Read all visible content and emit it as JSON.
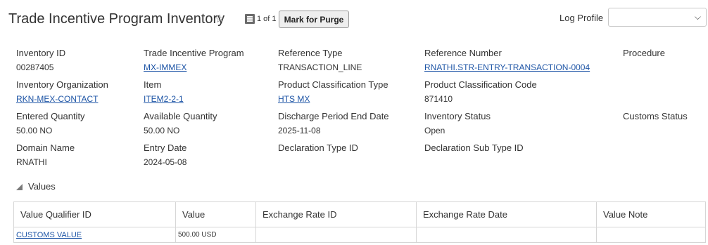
{
  "header": {
    "title": "Trade Incentive Program Inventory",
    "pager": "1 of 1",
    "mark_purge_label": "Mark for Purge",
    "log_profile_label": "Log Profile",
    "log_profile_value": ""
  },
  "fields": {
    "inventory_id": {
      "label": "Inventory ID",
      "value": "00287405"
    },
    "trade_incentive_program": {
      "label": "Trade Incentive Program",
      "value": "MX-IMMEX"
    },
    "reference_type": {
      "label": "Reference Type",
      "value": "TRANSACTION_LINE"
    },
    "reference_number": {
      "label": "Reference Number",
      "value": "RNATHI.STR-ENTRY-TRANSACTION-0004"
    },
    "procedure": {
      "label": "Procedure",
      "value": ""
    },
    "inventory_organization": {
      "label": "Inventory Organization",
      "value": "RKN-MEX-CONTACT"
    },
    "item": {
      "label": "Item",
      "value": "ITEM2-2-1"
    },
    "product_classification_type": {
      "label": "Product Classification Type",
      "value": "HTS MX"
    },
    "product_classification_code": {
      "label": "Product Classification Code",
      "value": "871410"
    },
    "entered_quantity": {
      "label": "Entered Quantity",
      "value": "50.00 NO"
    },
    "available_quantity": {
      "label": "Available Quantity",
      "value": "50.00 NO"
    },
    "discharge_period_end_date": {
      "label": "Discharge Period End Date",
      "value": "2025-11-08"
    },
    "inventory_status": {
      "label": "Inventory Status",
      "value": "Open"
    },
    "customs_status": {
      "label": "Customs Status",
      "value": ""
    },
    "domain_name": {
      "label": "Domain Name",
      "value": "RNATHI"
    },
    "entry_date": {
      "label": "Entry Date",
      "value": "2024-05-08"
    },
    "declaration_type_id": {
      "label": "Declaration Type ID",
      "value": ""
    },
    "declaration_sub_type_id": {
      "label": "Declaration Sub Type ID",
      "value": ""
    }
  },
  "values_section": {
    "title": "Values",
    "columns": [
      "Value Qualifier ID",
      "Value",
      "Exchange Rate ID",
      "Exchange Rate Date",
      "Value Note"
    ],
    "rows": [
      {
        "qualifier": "CUSTOMS VALUE",
        "value": "500.00 USD",
        "exchange_rate_id": "",
        "exchange_rate_date": "",
        "note": ""
      }
    ]
  },
  "icons": {
    "favorite": "star-outline-icon",
    "list": "list-icon",
    "collapse": "triangle-down-icon",
    "dropdown": "chevron-down-icon"
  }
}
